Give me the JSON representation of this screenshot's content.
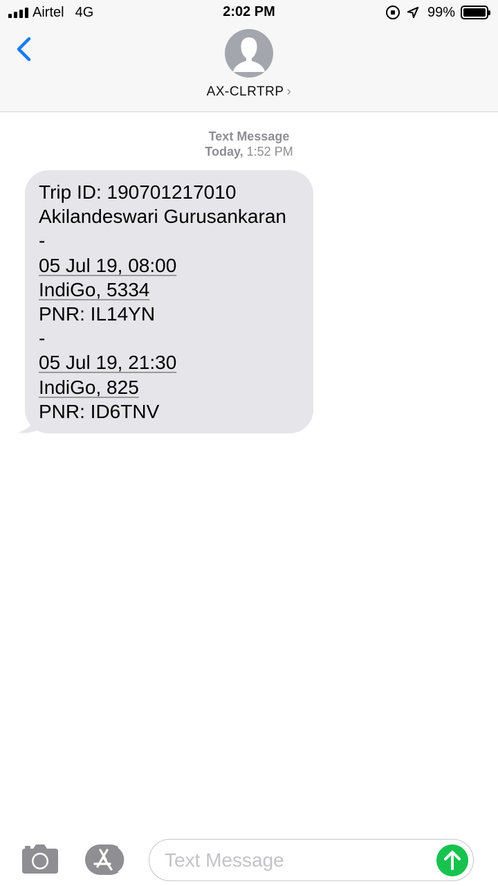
{
  "status_bar": {
    "carrier": "Airtel",
    "network": "4G",
    "time": "2:02 PM",
    "battery_percent": "99%",
    "battery_level": 0.99
  },
  "header": {
    "contact_name": "AX-CLRTRP",
    "chevron": "›",
    "back_icon": "chevron-left-icon",
    "avatar_icon": "person-silhouette-icon",
    "accent_color": "#1a7cf4"
  },
  "conversation": {
    "timestamp_type": "Text Message",
    "timestamp_day": "Today,",
    "timestamp_time": "1:52 PM",
    "message": {
      "trip_id": "Trip ID: 190701217010",
      "traveler": "Akilandeswari Gurusankaran",
      "separator_1": "-",
      "flight_1_datetime": "05 Jul 19, 08:00",
      "flight_1_flight": "IndiGo, 5334",
      "flight_1_pnr": "PNR: IL14YN",
      "separator_2": "-",
      "flight_2_datetime": "05 Jul 19, 21:30",
      "flight_2_flight": "IndiGo, 825",
      "flight_2_pnr": "PNR: ID6TNV"
    },
    "bubble_color": "#e5e5ea"
  },
  "input_bar": {
    "placeholder": "Text Message",
    "value": "",
    "camera_icon": "camera-icon",
    "appstore_icon": "app-store-icon",
    "send_icon": "arrow-up-icon",
    "send_color": "#17c34e"
  }
}
